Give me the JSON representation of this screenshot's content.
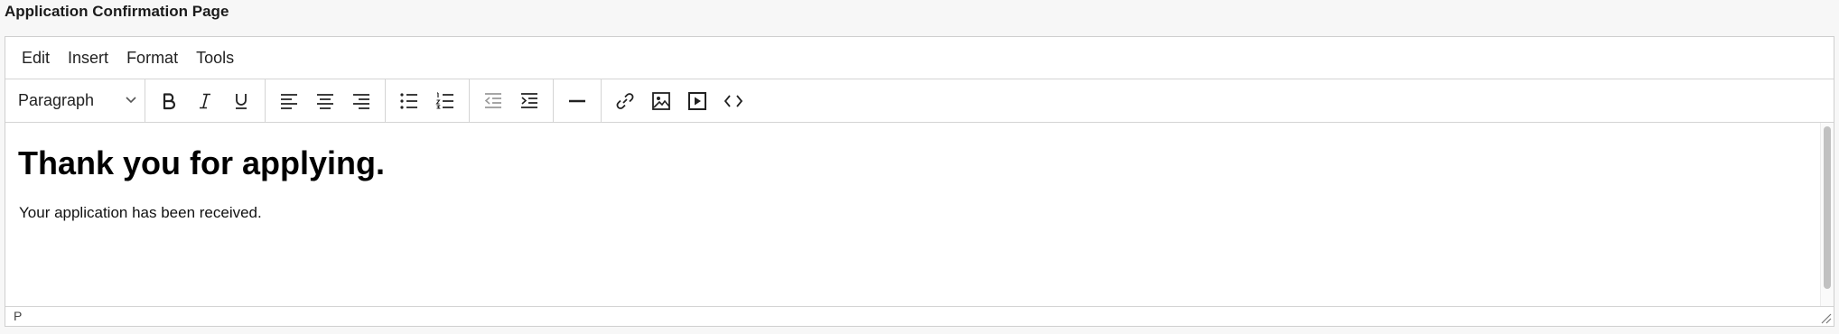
{
  "field": {
    "label": "Application Confirmation Page"
  },
  "menubar": {
    "items": [
      "Edit",
      "Insert",
      "Format",
      "Tools"
    ]
  },
  "toolbar": {
    "block_format": "Paragraph",
    "buttons": [
      "bold-icon",
      "italic-icon",
      "underline-icon",
      "align-left-icon",
      "align-center-icon",
      "align-right-icon",
      "bullet-list-icon",
      "numbered-list-icon",
      "outdent-icon",
      "indent-icon",
      "horizontal-rule-icon",
      "link-icon",
      "image-icon",
      "media-icon",
      "source-code-icon"
    ]
  },
  "content": {
    "heading": "Thank you for applying.",
    "paragraph": "Your application has been received."
  },
  "statusbar": {
    "path": "P"
  },
  "colors": {
    "border": "#cfcfcf",
    "toolbar_icon": "#222222",
    "disabled_icon": "#9a9a9a"
  }
}
